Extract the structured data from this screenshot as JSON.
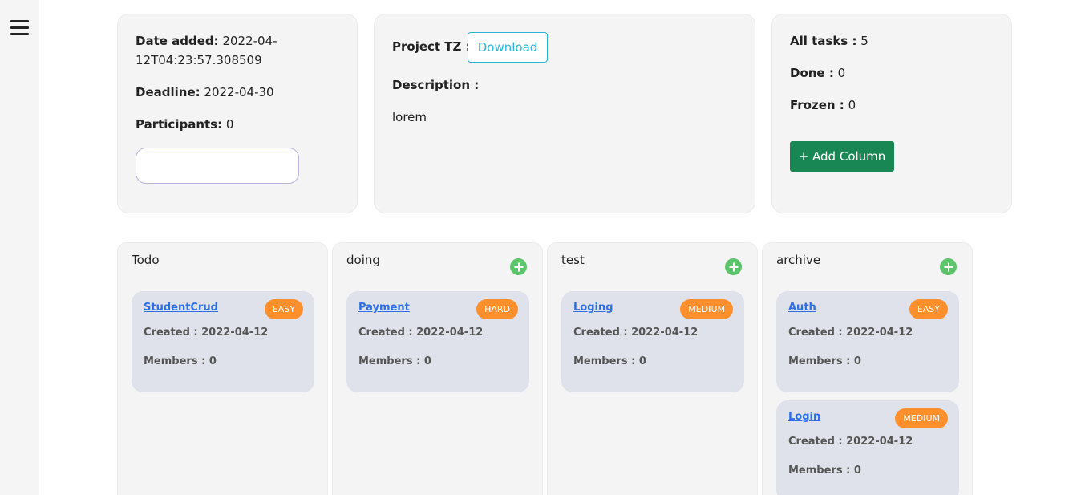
{
  "sidebar": {
    "menu_icon": "hamburger-menu-icon"
  },
  "info": {
    "date_added_label": "Date added:",
    "date_added_value_line1": "2022-04-",
    "date_added_value_line2": "12T04:23:57.308509",
    "deadline_label": "Deadline:",
    "deadline_value": "2022-04-30",
    "participants_label": "Participants:",
    "participants_value": "0",
    "participants_input_value": ""
  },
  "project": {
    "tz_label": "Project TZ :",
    "download_label": "Download",
    "description_label": "Description :",
    "description_value": "lorem"
  },
  "stats": {
    "all_tasks_label": "All tasks :",
    "all_tasks_value": "5",
    "done_label": "Done :",
    "done_value": "0",
    "frozen_label": "Frozen :",
    "frozen_value": "0",
    "add_column_label": "+ Add Column"
  },
  "colors": {
    "accent_green": "#198754",
    "badge_orange": "#fd8f2d",
    "link_blue": "#2f6fe4",
    "add_icon_green": "#5cc46a",
    "outline_cyan": "#2bb4d6"
  },
  "columns": [
    {
      "title": "Todo",
      "has_add": false,
      "tasks": [
        {
          "name": "StudentCrud",
          "difficulty": "EASY",
          "created": "Created : 2022-04-12",
          "members": "Members : 0"
        }
      ]
    },
    {
      "title": "doing",
      "has_add": true,
      "tasks": [
        {
          "name": "Payment",
          "difficulty": "HARD",
          "created": "Created : 2022-04-12",
          "members": "Members : 0"
        }
      ]
    },
    {
      "title": "test",
      "has_add": true,
      "tasks": [
        {
          "name": "Loging",
          "difficulty": "MEDIUM",
          "created": "Created : 2022-04-12",
          "members": "Members : 0"
        }
      ]
    },
    {
      "title": "archive",
      "has_add": true,
      "tasks": [
        {
          "name": "Auth",
          "difficulty": "EASY",
          "created": "Created : 2022-04-12",
          "members": "Members : 0"
        },
        {
          "name": "Login",
          "difficulty": "MEDIUM",
          "created": "Created : 2022-04-12",
          "members": "Members : 0"
        }
      ]
    }
  ]
}
